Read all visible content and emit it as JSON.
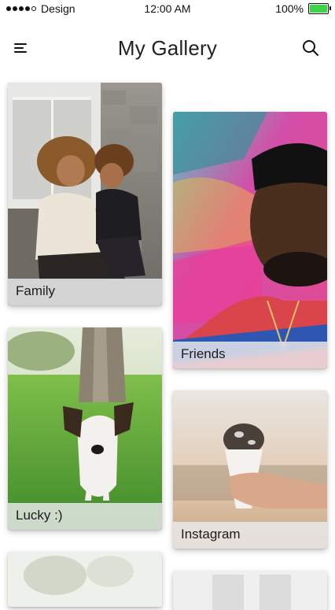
{
  "status_bar": {
    "carrier": "Design",
    "time": "12:00 AM",
    "battery": "100%",
    "battery_color": "#3fd24a"
  },
  "header": {
    "title": "My Gallery",
    "menu_icon": "hamburger-menu-icon",
    "search_icon": "search-icon"
  },
  "gallery": {
    "albums": [
      {
        "label": "Family"
      },
      {
        "label": "Friends"
      },
      {
        "label": "Lucky :)"
      },
      {
        "label": "Instagram"
      }
    ]
  }
}
